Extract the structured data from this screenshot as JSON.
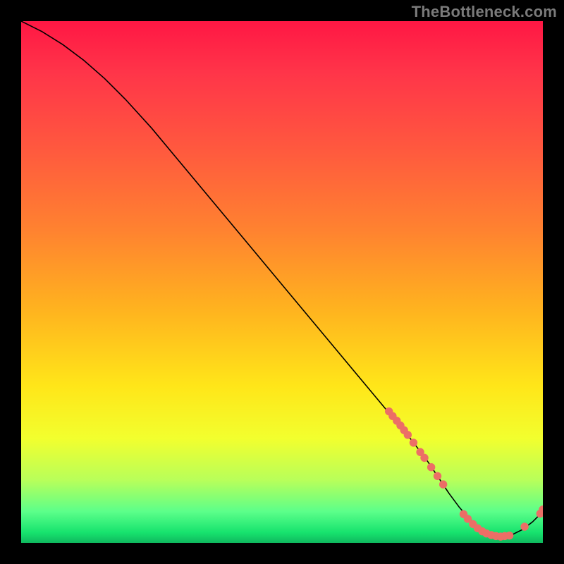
{
  "watermark": "TheBottleneck.com",
  "colors": {
    "background": "#000000",
    "watermark_text": "#7a7a7a",
    "curve": "#000000",
    "scatter_point": "#ec6e66",
    "gradient_stops": [
      "#ff1744",
      "#ff3549",
      "#ff5a3e",
      "#ff8230",
      "#ffb21f",
      "#ffe619",
      "#f2ff2e",
      "#b8ff5a",
      "#5cff8a",
      "#17e36e",
      "#0fb85e"
    ]
  },
  "chart_data": {
    "type": "line",
    "title": "",
    "xlabel": "",
    "ylabel": "",
    "xlim": [
      0,
      100
    ],
    "ylim": [
      0,
      100
    ],
    "series": [
      {
        "name": "curve",
        "x": [
          0,
          4,
          8,
          12,
          16,
          20,
          25,
          30,
          35,
          40,
          45,
          50,
          55,
          60,
          65,
          70,
          75,
          78,
          80,
          82,
          84,
          86,
          88,
          90,
          92,
          94,
          96,
          98,
          100
        ],
        "y": [
          100,
          98,
          95.5,
          92.5,
          89,
          85,
          79.5,
          73.5,
          67.5,
          61.5,
          55.5,
          49.5,
          43.5,
          37.5,
          31.5,
          25.5,
          19.5,
          15.5,
          12.5,
          9.5,
          6.8,
          4.5,
          2.8,
          1.6,
          1.2,
          1.5,
          2.5,
          4.0,
          6.0
        ]
      }
    ],
    "scatter": [
      {
        "x": 70.5,
        "y": 25.2
      },
      {
        "x": 71.2,
        "y": 24.3
      },
      {
        "x": 72.0,
        "y": 23.4
      },
      {
        "x": 72.7,
        "y": 22.5
      },
      {
        "x": 73.4,
        "y": 21.6
      },
      {
        "x": 74.1,
        "y": 20.7
      },
      {
        "x": 75.2,
        "y": 19.2
      },
      {
        "x": 76.5,
        "y": 17.4
      },
      {
        "x": 77.3,
        "y": 16.3
      },
      {
        "x": 78.6,
        "y": 14.5
      },
      {
        "x": 79.8,
        "y": 12.8
      },
      {
        "x": 80.9,
        "y": 11.2
      },
      {
        "x": 84.8,
        "y": 5.5
      },
      {
        "x": 85.6,
        "y": 4.6
      },
      {
        "x": 86.6,
        "y": 3.6
      },
      {
        "x": 87.5,
        "y": 2.8
      },
      {
        "x": 88.4,
        "y": 2.2
      },
      {
        "x": 89.2,
        "y": 1.8
      },
      {
        "x": 90.1,
        "y": 1.5
      },
      {
        "x": 91.0,
        "y": 1.3
      },
      {
        "x": 91.9,
        "y": 1.2
      },
      {
        "x": 92.7,
        "y": 1.3
      },
      {
        "x": 93.6,
        "y": 1.4
      },
      {
        "x": 96.5,
        "y": 3.1
      },
      {
        "x": 99.5,
        "y": 5.6
      },
      {
        "x": 100.0,
        "y": 6.4
      }
    ]
  }
}
